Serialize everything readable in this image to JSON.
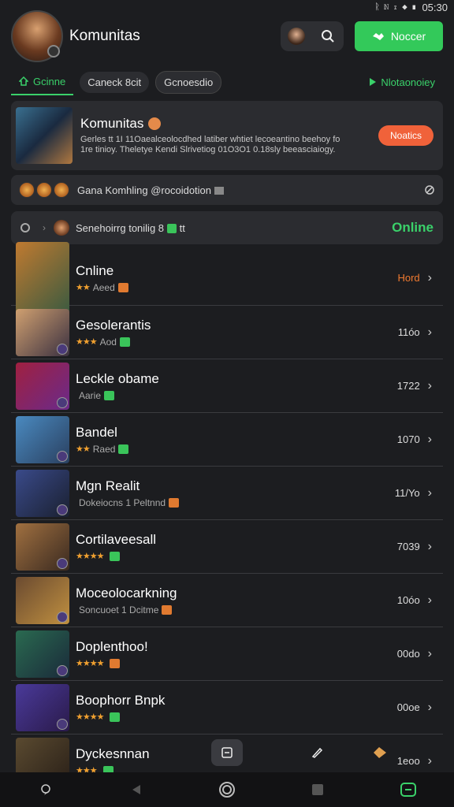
{
  "status": {
    "icons": "ᚱ ℕ ⧖ ◆ ▮",
    "time": "05:30"
  },
  "header": {
    "title": "Komunitas",
    "primary_button": "Noccer"
  },
  "tabs": [
    {
      "label": "Gcinne"
    },
    {
      "label": "Caneck 8cit"
    },
    {
      "label": "Gcnoesdio"
    },
    {
      "label": "Nlotaonoiey"
    }
  ],
  "featured": {
    "title": "Komunitas",
    "description": "Gerles tt 1I 11Oaealceolocdhed latiber whtiet lecoeantino beehoy fo  1re tinioy. Theletye Kendi Slrivetiog 01O3O1 0.18sly beeasciaiogy.",
    "button": "Noatics"
  },
  "activity": {
    "text": "Gana Komhling @rocoidotion"
  },
  "online_bar": {
    "text": "Senehoirrg tonilig 8",
    "badge": "tt",
    "status": "Online"
  },
  "list": [
    {
      "title": "Cnline",
      "sub": "Aeed",
      "value": "Hord",
      "value_orange": true,
      "stars": "★★",
      "green": false
    },
    {
      "title": "Gesolerantis",
      "sub": "Aod",
      "value": "11óo",
      "stars": "★★★",
      "green": true
    },
    {
      "title": "Leckle obame",
      "sub": "Aarie",
      "value": "1722",
      "stars": "",
      "green": true
    },
    {
      "title": "Bandel",
      "sub": "Raed",
      "value": "1070",
      "stars": "★★",
      "green": true
    },
    {
      "title": "Mgn Realit",
      "sub": "Dokeiocns 1 Peltnnd",
      "value": "11/Yo",
      "stars": "",
      "green": false
    },
    {
      "title": "Cortilaveesall",
      "sub": "",
      "value": "7039",
      "stars": "★★★★",
      "green": true
    },
    {
      "title": "Moceolocarkning",
      "sub": "Soncuoet 1 Dcitme",
      "value": "10óo",
      "stars": "",
      "green": false
    },
    {
      "title": "Doplenthoo!",
      "sub": "",
      "value": "00do",
      "stars": "★★★★",
      "green": false
    },
    {
      "title": "Boophorr Bnpk",
      "sub": "",
      "value": "00oe",
      "stars": "★★★★",
      "green": true
    },
    {
      "title": "Dyckesnnan",
      "sub": "",
      "value": "1eoo",
      "stars": "★★★",
      "green": true
    }
  ]
}
